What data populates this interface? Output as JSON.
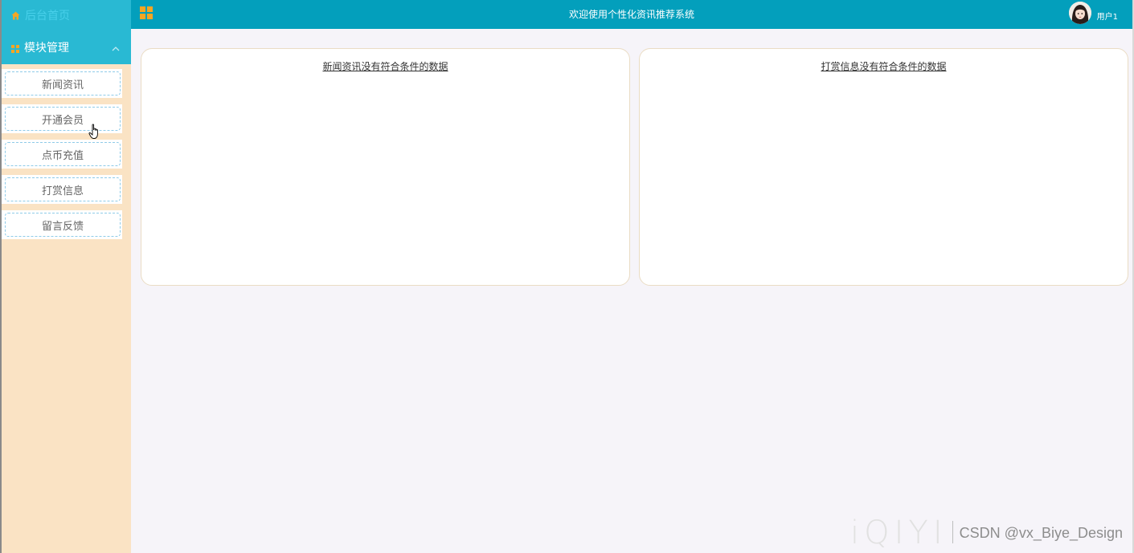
{
  "sidebar": {
    "home_label": "后台首页",
    "group_label": "模块管理",
    "items": [
      {
        "label": "新闻资讯"
      },
      {
        "label": "开通会员"
      },
      {
        "label": "点币充值"
      },
      {
        "label": "打赏信息"
      },
      {
        "label": "留言反馈"
      }
    ]
  },
  "header": {
    "title": "欢迎使用个性化资讯推荐系统",
    "username": "用户1"
  },
  "cards": [
    {
      "title": "新闻资讯没有符合条件的数据"
    },
    {
      "title": "打赏信息没有符合条件的数据"
    }
  ],
  "watermark": {
    "logo": "iQIYI",
    "credit": "CSDN @vx_Biye_Design"
  },
  "colors": {
    "topbar": "#039fbc",
    "sidebar_head": "#29b9d3",
    "sidebar_bg": "#fae3c4",
    "icon_accent": "#f5a623",
    "page_bg": "#f6f4f9"
  },
  "icons": {
    "home": "home-icon",
    "group": "grid-icon",
    "chevron": "chevron-up-icon",
    "apps": "apps-grid-icon"
  }
}
